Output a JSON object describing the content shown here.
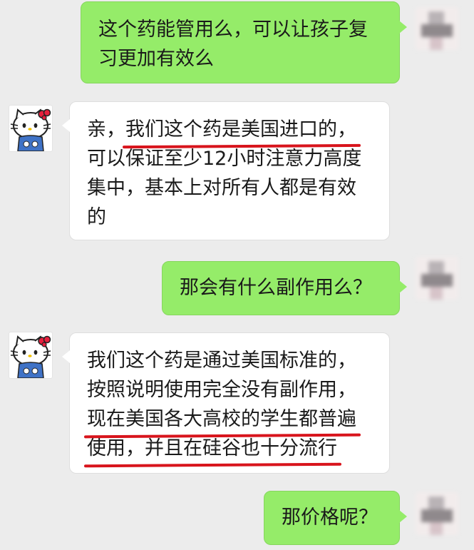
{
  "conversation": {
    "messages": [
      {
        "side": "outgoing",
        "lines": [
          "这个药能管用么，可以让孩子复",
          "习更加有效么"
        ]
      },
      {
        "side": "incoming",
        "line1_prefix": "亲，",
        "line1_highlight": "我们这个药是美国进口的，",
        "lines_rest": [
          "可以保证至少12小时注意力高度",
          "集中，基本上对所有人都是有效",
          "的"
        ]
      },
      {
        "side": "outgoing",
        "lines": [
          "那会有什么副作用么？"
        ]
      },
      {
        "side": "incoming",
        "lines": [
          "我们这个药是通过美国标准的，",
          "按照说明使用完全没有副作用，"
        ],
        "highlight_lines": [
          "现在美国各大高校的学生都普遍",
          "使用，并且在硅谷也十分流行"
        ]
      },
      {
        "side": "outgoing",
        "lines": [
          "那价格呢？"
        ]
      }
    ]
  },
  "colors": {
    "outgoing_bubble": "#95ec69",
    "incoming_bubble": "#ffffff",
    "background": "#ececec",
    "underline": "#d8141c"
  },
  "icons": {
    "user_avatar": "blurred-user-avatar",
    "merchant_avatar": "hello-kitty-avatar"
  }
}
